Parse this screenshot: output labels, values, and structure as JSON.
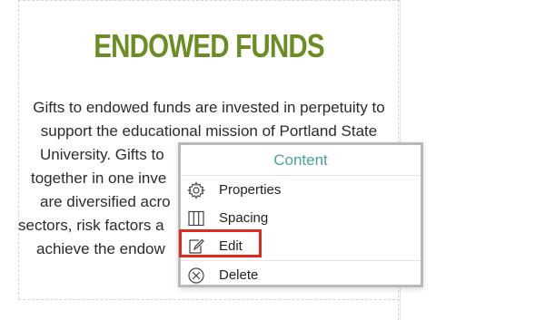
{
  "content": {
    "heading": "ENDOWED FUNDS",
    "paragraph_lines": [
      "Gifts to endowed funds are invested in perpetuity to",
      "support the educational mission of Portland State",
      "University. Gifts to",
      "together in one inve",
      "are diversified acro",
      "sectors, risk factors a",
      "achieve the endow"
    ]
  },
  "context_menu": {
    "title": "Content",
    "items": [
      {
        "label": "Properties",
        "icon": "gear-icon"
      },
      {
        "label": "Spacing",
        "icon": "columns-icon"
      },
      {
        "label": "Edit",
        "icon": "edit-icon"
      },
      {
        "label": "Delete",
        "icon": "delete-icon"
      }
    ]
  },
  "colors": {
    "heading": "#6a8e23",
    "menu_title": "#4aa39a",
    "highlight": "#e0281c"
  }
}
